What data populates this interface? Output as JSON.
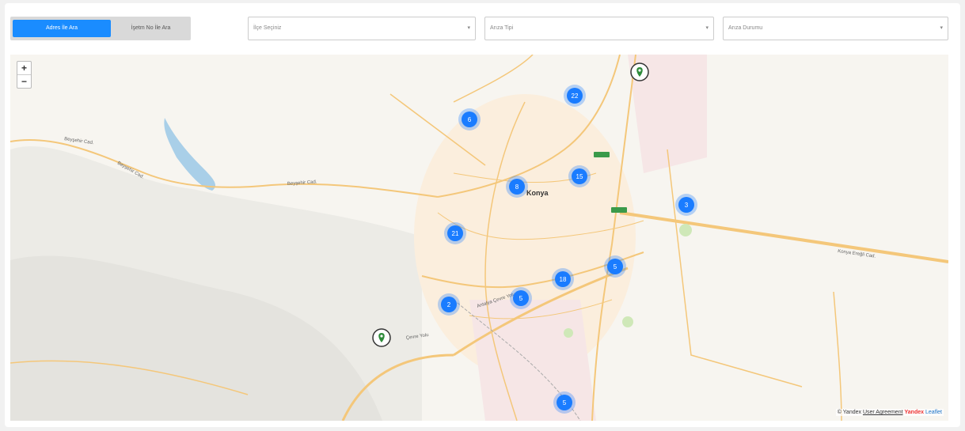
{
  "search_toggle": {
    "address_label": "Adres İle Ara",
    "job_label": "İşetm No İle Ara"
  },
  "filters": {
    "district_placeholder": "İlçe Seçiniz",
    "fault_type_placeholder": "Arıza Tipi",
    "fault_status_placeholder": "Arıza Durumu",
    "caret_glyph": "▾"
  },
  "map": {
    "zoom_in": "+",
    "zoom_out": "−",
    "city_label": "Konya",
    "road_labels": [
      "Beyşehir Cad.",
      "Beyşehir Cad.",
      "Beyşehir Cad.",
      "Konya Ereğli Cad.",
      "Antalya Çevre Yolu",
      "Çevre Yolu"
    ],
    "clusters": [
      {
        "count": "22"
      },
      {
        "count": "6"
      },
      {
        "count": "8"
      },
      {
        "count": "15"
      },
      {
        "count": "3"
      },
      {
        "count": "21"
      },
      {
        "count": "5"
      },
      {
        "count": "18"
      },
      {
        "count": "2"
      },
      {
        "count": "5"
      },
      {
        "count": "5"
      }
    ],
    "pin_count": 2,
    "attribution": {
      "copyright": "© Yandex",
      "agreement": "User Agreement",
      "brand_top": "Yandex",
      "brand_bottom": "Leaflet"
    },
    "colors": {
      "cluster": "#1a7cff",
      "pin": "#2e8b3a",
      "road": "#f4c77a",
      "water": "#a9cfe8"
    }
  }
}
